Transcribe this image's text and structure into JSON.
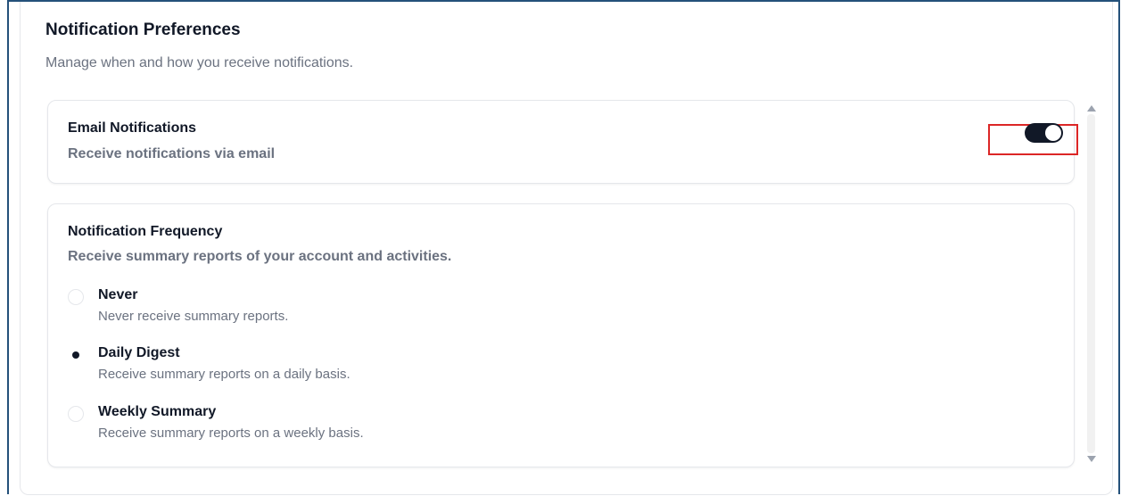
{
  "section": {
    "title": "Notification Preferences",
    "subtitle": "Manage when and how you receive notifications."
  },
  "email": {
    "title": "Email Notifications",
    "description": "Receive notifications via email",
    "enabled": true
  },
  "frequency": {
    "title": "Notification Frequency",
    "description": "Receive summary reports of your account and activities.",
    "selected": "Daily Digest",
    "options": [
      {
        "label": "Never",
        "description": "Never receive summary reports."
      },
      {
        "label": "Daily Digest",
        "description": "Receive summary reports on a daily basis."
      },
      {
        "label": "Weekly Summary",
        "description": "Receive summary reports on a weekly basis."
      }
    ]
  },
  "colors": {
    "highlight": "#dc2626",
    "toggle_on": "#111827",
    "frame": "#24517a"
  }
}
